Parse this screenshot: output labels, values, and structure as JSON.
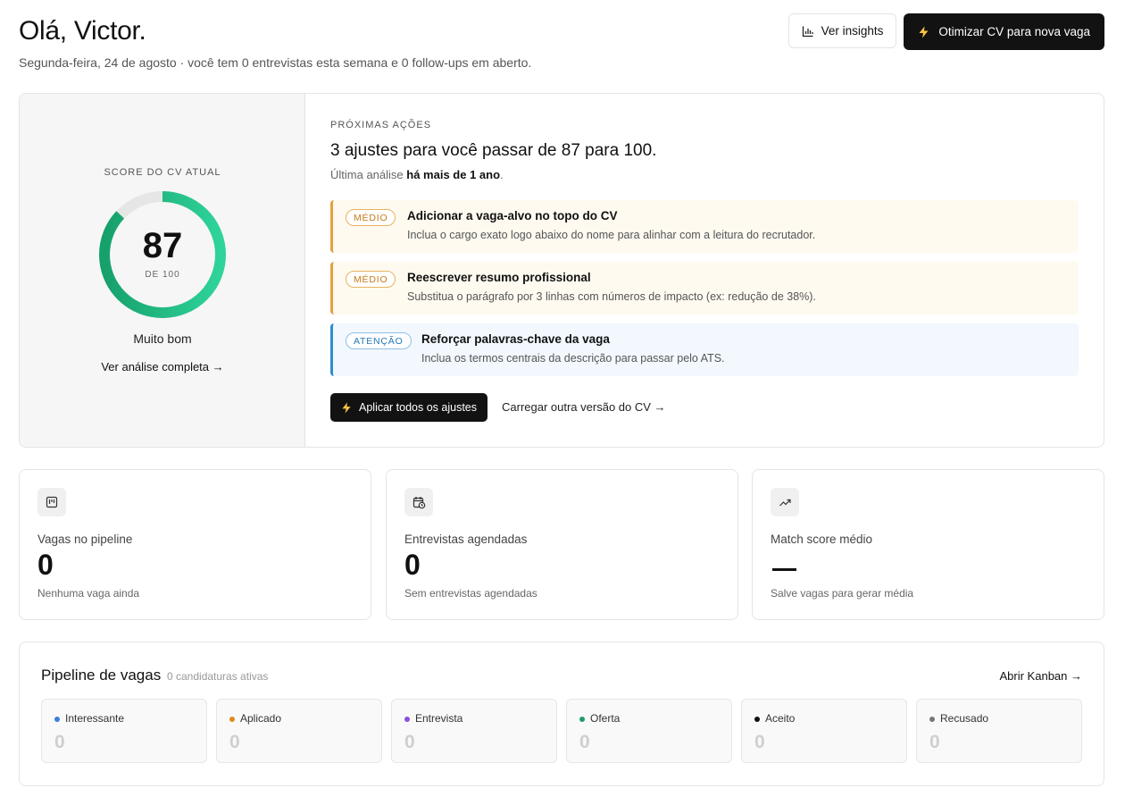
{
  "header": {
    "greeting": "Olá, Victor.",
    "subtitle": "Segunda-feira, 24 de agosto · você tem 0 entrevistas esta semana e 0 follow-ups em aberto.",
    "insights_label": "Ver insights",
    "optimize_label": "Otimizar CV para nova vaga",
    "insights_icon": "bar-chart-icon",
    "optimize_icon": "lightning-icon"
  },
  "score": {
    "label": "SCORE DO CV ATUAL",
    "value": "87",
    "value_fraction": 0.87,
    "out_of": "DE 100",
    "rating": "Muito bom",
    "link": "Ver análise completa →",
    "gauge_color": "#1fb87f",
    "track_color": "#e6e6e6"
  },
  "next_actions": {
    "label": "PRÓXIMAS AÇÕES",
    "title": "3 ajustes para você passar de 87 para 100.",
    "last_prefix": "Última análise ",
    "last_value": "há mais de 1 ano",
    "last_suffix": ".",
    "items": [
      {
        "badge": "MÉDIO",
        "title": "Adicionar a vaga-alvo no topo do CV",
        "desc": "Inclua o cargo exato logo abaixo do nome para alinhar com a leitura do recrutador."
      },
      {
        "badge": "MÉDIO",
        "title": "Reescrever resumo profissional",
        "desc": "Substitua o parágrafo por 3 linhas com números de impacto (ex: redução de 38%)."
      },
      {
        "badge": "ATENÇÃO",
        "title": "Reforçar palavras-chave da vaga",
        "desc": "Inclua os termos centrais da descrição para passar pelo ATS."
      }
    ],
    "apply_label": "Aplicar todos os ajustes",
    "upload_label": "Carregar outra versão do CV →"
  },
  "stats": [
    {
      "icon": "kanban-icon",
      "label": "Vagas no pipeline",
      "value": "0",
      "note": "Nenhuma vaga ainda"
    },
    {
      "icon": "calendar-clock-icon",
      "label": "Entrevistas agendadas",
      "value": "0",
      "note": "Sem entrevistas agendadas"
    },
    {
      "icon": "trending-up-icon",
      "label": "Match score médio",
      "value": "—",
      "note": "Salve vagas para gerar média"
    }
  ],
  "pipeline": {
    "title": "Pipeline de vagas",
    "count": "0 candidaturas ativas",
    "link": "Abrir Kanban →",
    "stages": [
      {
        "name": "Interessante",
        "value": "0",
        "color": "#3b7fd9"
      },
      {
        "name": "Aplicado",
        "value": "0",
        "color": "#e0891a"
      },
      {
        "name": "Entrevista",
        "value": "0",
        "color": "#8a4fe0"
      },
      {
        "name": "Oferta",
        "value": "0",
        "color": "#1f9d6a"
      },
      {
        "name": "Aceito",
        "value": "0",
        "color": "#111111"
      },
      {
        "name": "Recusado",
        "value": "0",
        "color": "#777777"
      }
    ]
  }
}
